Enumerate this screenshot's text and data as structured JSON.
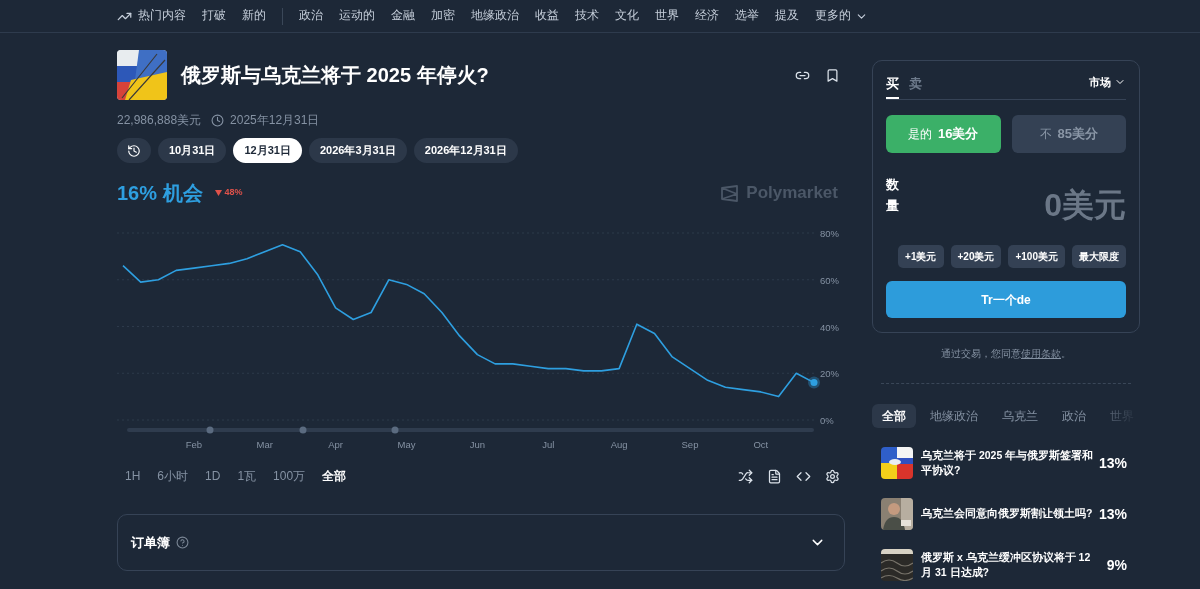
{
  "nav": {
    "primary": [
      {
        "label": "热门内容",
        "kind": "trending"
      },
      {
        "label": "打破",
        "kind": "plain"
      },
      {
        "label": "新的",
        "kind": "plain"
      }
    ],
    "categories": [
      "政治",
      "运动的",
      "金融",
      "加密",
      "地缘政治",
      "收益",
      "技术",
      "文化",
      "世界",
      "经济",
      "选举",
      "提及"
    ],
    "more": "更多的"
  },
  "market": {
    "title": "俄罗斯与乌克兰将于 2025 年停火?",
    "volume": "22,986,888美元",
    "end_date": "2025年12月31日",
    "date_options": [
      {
        "label": "10月31日",
        "selected": false
      },
      {
        "label": "12月31日",
        "selected": true
      },
      {
        "label": "2026年3月31日",
        "selected": false
      },
      {
        "label": "2026年12月31日",
        "selected": false
      }
    ],
    "chance": "16% 机会",
    "change": "48%",
    "brand": "Polymarket",
    "chart_data": {
      "type": "line",
      "categories": [
        null,
        null,
        null,
        null,
        "Feb",
        null,
        null,
        null,
        "Mar",
        null,
        null,
        null,
        "Apr",
        null,
        null,
        null,
        "May",
        null,
        null,
        null,
        "Jun",
        null,
        null,
        null,
        "Jul",
        null,
        null,
        null,
        "Aug",
        null,
        null,
        null,
        "Sep",
        null,
        null,
        null,
        "Oct",
        null,
        null,
        null
      ],
      "series": [
        {
          "color": "#2e9fe0",
          "values": [
            66,
            59,
            60,
            64,
            65,
            66,
            67,
            69,
            72,
            75,
            72,
            62,
            48,
            43,
            46,
            60,
            58,
            54,
            46,
            36,
            28,
            24,
            24,
            23,
            22,
            22,
            21,
            21,
            22,
            41,
            37,
            27,
            22,
            17,
            14,
            13,
            12,
            10,
            20,
            16
          ]
        }
      ],
      "ylim": [
        0,
        80
      ],
      "grid": true,
      "yticks": [
        {
          "value": 0,
          "label": "0%"
        },
        {
          "value": 20,
          "label": "20%"
        },
        {
          "value": 40,
          "label": "40%"
        },
        {
          "value": 60,
          "label": "60%"
        },
        {
          "value": 80,
          "label": "80%"
        }
      ]
    },
    "ranges": [
      {
        "label": "1H",
        "selected": false
      },
      {
        "label": "6小时",
        "selected": false
      },
      {
        "label": "1D",
        "selected": false
      },
      {
        "label": "1瓦",
        "selected": false
      },
      {
        "label": "100万",
        "selected": false
      },
      {
        "label": "全部",
        "selected": true
      }
    ],
    "order_book": {
      "title": "订单簿",
      "expanded": false
    }
  },
  "trade": {
    "sides": [
      {
        "label": "买",
        "selected": true
      },
      {
        "label": "卖",
        "selected": false
      }
    ],
    "order_type": "市场",
    "outcomes": [
      {
        "label": "是的",
        "price": "16美分",
        "kind": "yes",
        "selected": true
      },
      {
        "label": "不",
        "price": "85美分",
        "kind": "no",
        "selected": false
      }
    ],
    "amount_label": "数量",
    "amount": "0美元",
    "quick_amounts": [
      "+1美元",
      "+20美元",
      "+100美元",
      "最大限度"
    ],
    "submit": "Tr一个de",
    "terms": {
      "text": "通过交易，您同意",
      "link": "使用条款",
      "end": "。"
    }
  },
  "related": {
    "tags": [
      {
        "label": "全部",
        "selected": true
      },
      {
        "label": "地缘政治",
        "selected": false
      },
      {
        "label": "乌克兰",
        "selected": false
      },
      {
        "label": "政治",
        "selected": false
      },
      {
        "label": "世界",
        "selected": false
      }
    ],
    "markets": [
      {
        "title": "乌克兰将于 2025 年与俄罗斯签署和平协议?",
        "chance": "13%",
        "kind": "flags"
      },
      {
        "title": "乌克兰会同意向俄罗斯割让领土吗?",
        "chance": "13%",
        "kind": "person"
      },
      {
        "title": "俄罗斯 x 乌克兰缓冲区协议将于 12 月 31 日达成?",
        "chance": "9%",
        "kind": "wire"
      }
    ]
  }
}
